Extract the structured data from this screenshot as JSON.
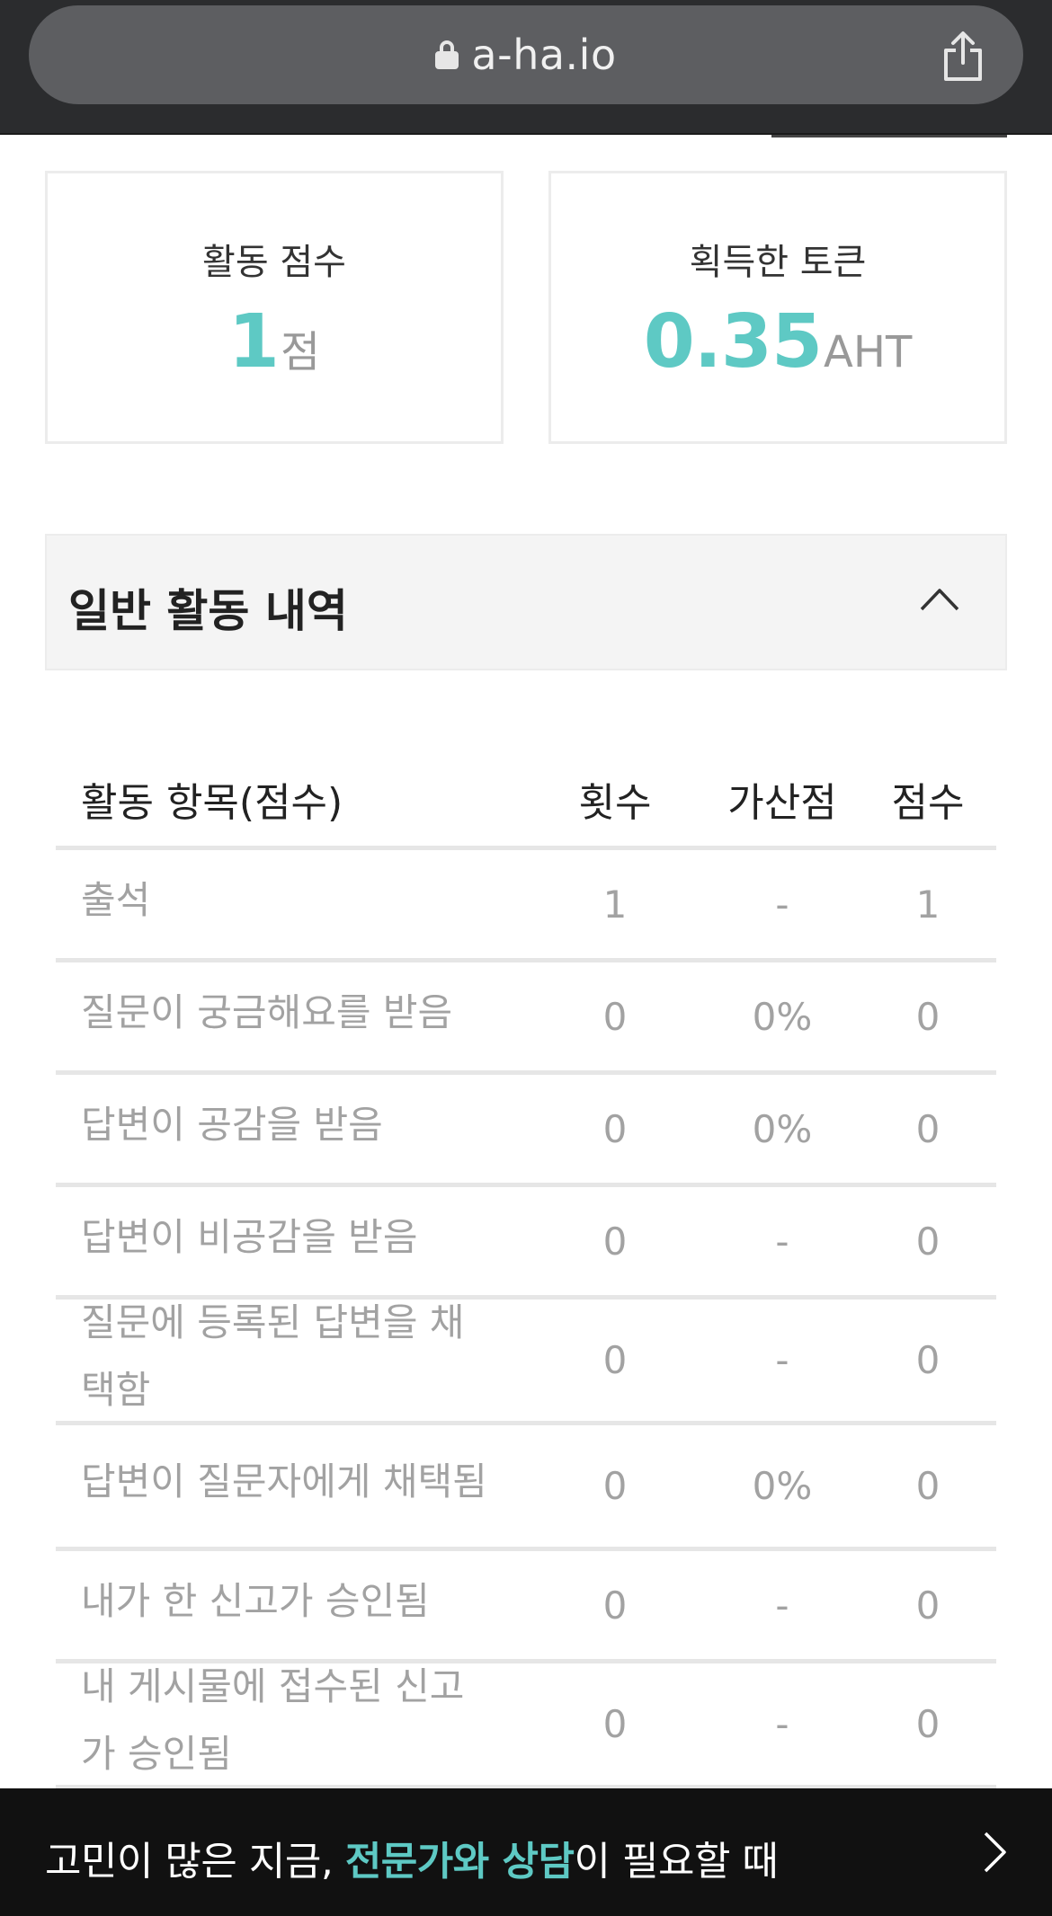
{
  "browser": {
    "url": "a-ha.io"
  },
  "stats": {
    "activity": {
      "title": "활동 점수",
      "value": "1",
      "unit": "점"
    },
    "token": {
      "title": "획득한 토큰",
      "value": "0.35",
      "unit": "AHT"
    }
  },
  "section": {
    "title": "일반 활동 내역"
  },
  "table": {
    "headers": {
      "item": "활동 항목(점수)",
      "count": "횟수",
      "bonus": "가산점",
      "score": "점수"
    },
    "rows": [
      {
        "item": "출석",
        "count": "1",
        "bonus": "-",
        "score": "1"
      },
      {
        "item": "질문이 궁금해요를 받음",
        "count": "0",
        "bonus": "0%",
        "score": "0"
      },
      {
        "item": "답변이 공감을 받음",
        "count": "0",
        "bonus": "0%",
        "score": "0"
      },
      {
        "item": "답변이 비공감을 받음",
        "count": "0",
        "bonus": "-",
        "score": "0"
      },
      {
        "item": "질문에 등록된 답변을 채택함",
        "count": "0",
        "bonus": "-",
        "score": "0"
      },
      {
        "item": "답변이 질문자에게 채택됨",
        "count": "0",
        "bonus": "0%",
        "score": "0"
      },
      {
        "item": "내가 한 신고가 승인됨",
        "count": "0",
        "bonus": "-",
        "score": "0"
      },
      {
        "item": "내 게시물에 접수된 신고가 승인됨",
        "count": "0",
        "bonus": "-",
        "score": "0"
      }
    ]
  },
  "banner": {
    "prefix": "고민이 많은 지금, ",
    "highlight": "전문가와 상담",
    "suffix": "이 필요할 때"
  },
  "colors": {
    "accent": "#5ec9c4",
    "banner_bg": "#111111"
  }
}
